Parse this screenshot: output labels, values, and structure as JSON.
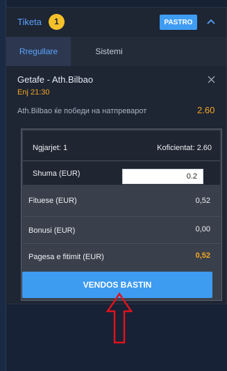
{
  "header": {
    "title": "Tiketa",
    "count": "1",
    "clear_label": "PASTRO"
  },
  "tabs": [
    {
      "label": "Rregullare"
    },
    {
      "label": "Sistemi"
    }
  ],
  "bet": {
    "match": "Getafe - Ath.Bilbao",
    "time": "Enj 21:30",
    "selection": "Ath.Bilbao ќе победи на натпреварот",
    "odds": "2.60"
  },
  "summary": {
    "events_label": "Ngjarjet: 1",
    "coefficient_label": "Koficientat: 2.60",
    "stake_label": "Shuma (EUR)",
    "stake_value": "0.2",
    "winnings_label": "Fituese (EUR)",
    "winnings_value": "0,52",
    "bonus_label": "Bonusi (EUR)",
    "bonus_value": "0,00",
    "payout_label": "Pagesa e fitimit (EUR)",
    "payout_value": "0,52"
  },
  "place_bet_label": "VENDOS BASTIN",
  "colors": {
    "accent": "#3d9bf0",
    "odds": "#f5a623",
    "badge": "#f5c02a",
    "arrow": "#e0121b"
  }
}
